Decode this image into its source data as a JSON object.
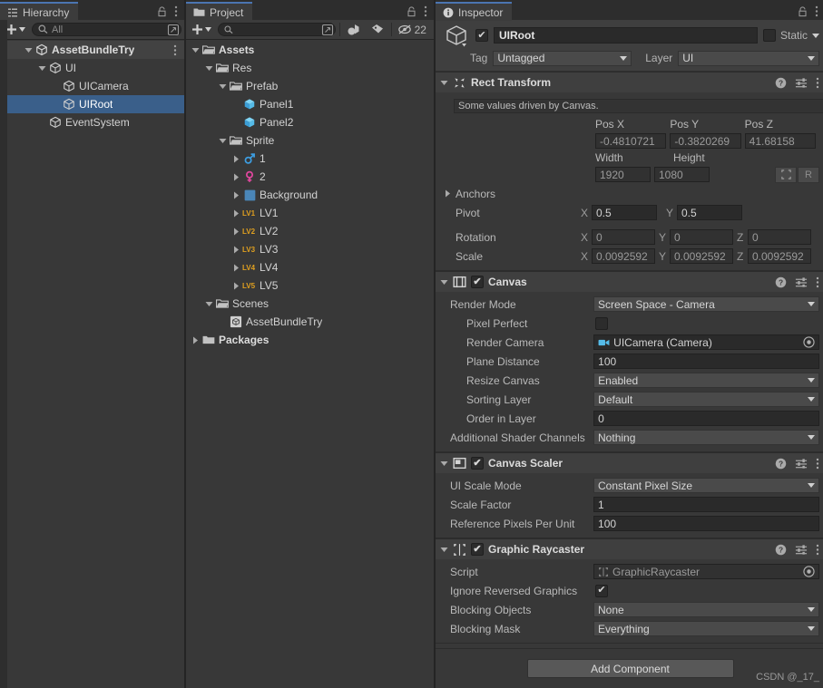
{
  "hierarchy": {
    "tab_label": "Hierarchy",
    "tab_icon": "hierarchy-icon",
    "toolbar": {
      "add_label": "+",
      "search_placeholder": "All"
    },
    "items": [
      {
        "label": "AssetBundleTry",
        "indent": 1,
        "icon": "scene-cube-icon",
        "arrow": "down",
        "bold": true,
        "selected": false,
        "kebab": true
      },
      {
        "label": "UI",
        "indent": 2,
        "icon": "gameobject-cube-icon",
        "arrow": "down",
        "bold": false,
        "selected": false,
        "kebab": false
      },
      {
        "label": "UICamera",
        "indent": 3,
        "icon": "gameobject-cube-icon",
        "arrow": "none",
        "bold": false,
        "selected": false,
        "kebab": false
      },
      {
        "label": "UIRoot",
        "indent": 3,
        "icon": "gameobject-cube-icon",
        "arrow": "none",
        "bold": false,
        "selected": true,
        "kebab": false
      },
      {
        "label": "EventSystem",
        "indent": 2,
        "icon": "gameobject-cube-icon",
        "arrow": "none",
        "bold": false,
        "selected": false,
        "kebab": false
      }
    ]
  },
  "project": {
    "tab_label": "Project",
    "tab_icon": "folder-icon",
    "toolbar": {
      "add_label": "+",
      "search_placeholder": "",
      "filter_type_icon": "filter-by-type-icon",
      "filter_label_icon": "filter-by-label-icon",
      "hidden_count_icon": "hidden-packages-icon",
      "hidden_count": "22"
    },
    "items": [
      {
        "label": "Assets",
        "indent": 0,
        "icon": "folder-open-icon",
        "arrow": "down",
        "bold": true
      },
      {
        "label": "Res",
        "indent": 1,
        "icon": "folder-open-icon",
        "arrow": "down",
        "bold": false
      },
      {
        "label": "Prefab",
        "indent": 2,
        "icon": "folder-open-icon",
        "arrow": "down",
        "bold": false
      },
      {
        "label": "Panel1",
        "indent": 3,
        "icon": "prefab-cube-icon",
        "arrow": "none",
        "bold": false
      },
      {
        "label": "Panel2",
        "indent": 3,
        "icon": "prefab-cube-icon",
        "arrow": "none",
        "bold": false
      },
      {
        "label": "Sprite",
        "indent": 2,
        "icon": "folder-open-icon",
        "arrow": "down",
        "bold": false
      },
      {
        "label": "1",
        "indent": 3,
        "icon": "sprite-male-icon",
        "arrow": "right",
        "bold": false
      },
      {
        "label": "2",
        "indent": 3,
        "icon": "sprite-female-icon",
        "arrow": "right",
        "bold": false
      },
      {
        "label": "Background",
        "indent": 3,
        "icon": "sprite-square-icon",
        "arrow": "right",
        "bold": false
      },
      {
        "label": "LV1",
        "indent": 3,
        "icon": "sprite-lv1-icon",
        "arrow": "right",
        "bold": false
      },
      {
        "label": "LV2",
        "indent": 3,
        "icon": "sprite-lv2-icon",
        "arrow": "right",
        "bold": false
      },
      {
        "label": "LV3",
        "indent": 3,
        "icon": "sprite-lv3-icon",
        "arrow": "right",
        "bold": false
      },
      {
        "label": "LV4",
        "indent": 3,
        "icon": "sprite-lv4-icon",
        "arrow": "right",
        "bold": false
      },
      {
        "label": "LV5",
        "indent": 3,
        "icon": "sprite-lv5-icon",
        "arrow": "right",
        "bold": false
      },
      {
        "label": "Scenes",
        "indent": 1,
        "icon": "folder-open-icon",
        "arrow": "down",
        "bold": false
      },
      {
        "label": "AssetBundleTry",
        "indent": 2,
        "icon": "scene-asset-icon",
        "arrow": "none",
        "bold": false
      },
      {
        "label": "Packages",
        "indent": 0,
        "icon": "folder-closed-icon",
        "arrow": "right",
        "bold": true
      }
    ]
  },
  "inspector": {
    "tab_label": "Inspector",
    "tab_icon": "info-icon",
    "object": {
      "enabled": true,
      "name": "UIRoot",
      "static_label": "Static",
      "static_checked": false,
      "tag_label": "Tag",
      "tag_value": "Untagged",
      "layer_label": "Layer",
      "layer_value": "UI"
    },
    "components": [
      {
        "name": "Rect Transform",
        "icon": "rect-transform-icon",
        "has_checkbox": false,
        "info_text": "Some values driven by Canvas.",
        "pos_headers": [
          "Pos X",
          "Pos Y",
          "Pos Z"
        ],
        "pos_values": [
          "-0.4810721",
          "-0.3820269",
          "41.68158"
        ],
        "size_headers": [
          "Width",
          "Height"
        ],
        "size_values": [
          "1920",
          "1080"
        ],
        "blueprint_button": "blueprint-mode-icon",
        "raw_button": "R",
        "anchors_label": "Anchors",
        "pivot_label": "Pivot",
        "pivot_values": [
          "0.5",
          "0.5"
        ],
        "rotation_label": "Rotation",
        "rotation_values": [
          "0",
          "0",
          "0"
        ],
        "scale_label": "Scale",
        "scale_values": [
          "0.0092592",
          "0.0092592",
          "0.0092592"
        ],
        "axes": [
          "X",
          "Y",
          "Z"
        ]
      },
      {
        "name": "Canvas",
        "icon": "canvas-icon",
        "has_checkbox": true,
        "checked": true,
        "fields": [
          {
            "label": "Render Mode",
            "type": "dropdown",
            "value": "Screen Space - Camera",
            "indent": 0
          },
          {
            "label": "Pixel Perfect",
            "type": "checkbox",
            "value": false,
            "indent": 1
          },
          {
            "label": "Render Camera",
            "type": "object",
            "value": "UICamera (Camera)",
            "indent": 1
          },
          {
            "label": "Plane Distance",
            "type": "text",
            "value": "100",
            "indent": 1
          },
          {
            "label": "Resize Canvas",
            "type": "dropdown",
            "value": "Enabled",
            "indent": 1
          },
          {
            "label": "Sorting Layer",
            "type": "dropdown",
            "value": "Default",
            "indent": 1
          },
          {
            "label": "Order in Layer",
            "type": "text",
            "value": "0",
            "indent": 1
          },
          {
            "label": "Additional Shader Channels",
            "type": "dropdown",
            "value": "Nothing",
            "indent": 0
          }
        ]
      },
      {
        "name": "Canvas Scaler",
        "icon": "canvas-scaler-icon",
        "has_checkbox": true,
        "checked": true,
        "fields": [
          {
            "label": "UI Scale Mode",
            "type": "dropdown",
            "value": "Constant Pixel Size",
            "indent": 0
          },
          {
            "label": "Scale Factor",
            "type": "text",
            "value": "1",
            "indent": 0
          },
          {
            "label": "Reference Pixels Per Unit",
            "type": "text",
            "value": "100",
            "indent": 0
          }
        ]
      },
      {
        "name": "Graphic Raycaster",
        "icon": "graphic-raycaster-icon",
        "has_checkbox": true,
        "checked": true,
        "fields": [
          {
            "label": "Script",
            "type": "script",
            "value": "GraphicRaycaster",
            "indent": 0,
            "disabled": true
          },
          {
            "label": "Ignore Reversed Graphics",
            "type": "checkbox",
            "value": true,
            "indent": 0
          },
          {
            "label": "Blocking Objects",
            "type": "dropdown",
            "value": "None",
            "indent": 0
          },
          {
            "label": "Blocking Mask",
            "type": "dropdown",
            "value": "Everything",
            "indent": 0
          }
        ]
      }
    ],
    "add_component_label": "Add Component",
    "watermark": "CSDN @_17_"
  },
  "colors": {
    "panel_bg": "#383838",
    "header_bg": "#3f3f3f",
    "selection_blue": "#3a5f8a",
    "tab_accent": "#4b75b1",
    "field_bg": "#2a2a2a",
    "dropdown_bg": "#4a4a4a",
    "sprite_male": "#3d9de0",
    "sprite_female": "#e0479e",
    "sprite_level": "#e0a020",
    "prefab_blue": "#55b5e8"
  }
}
